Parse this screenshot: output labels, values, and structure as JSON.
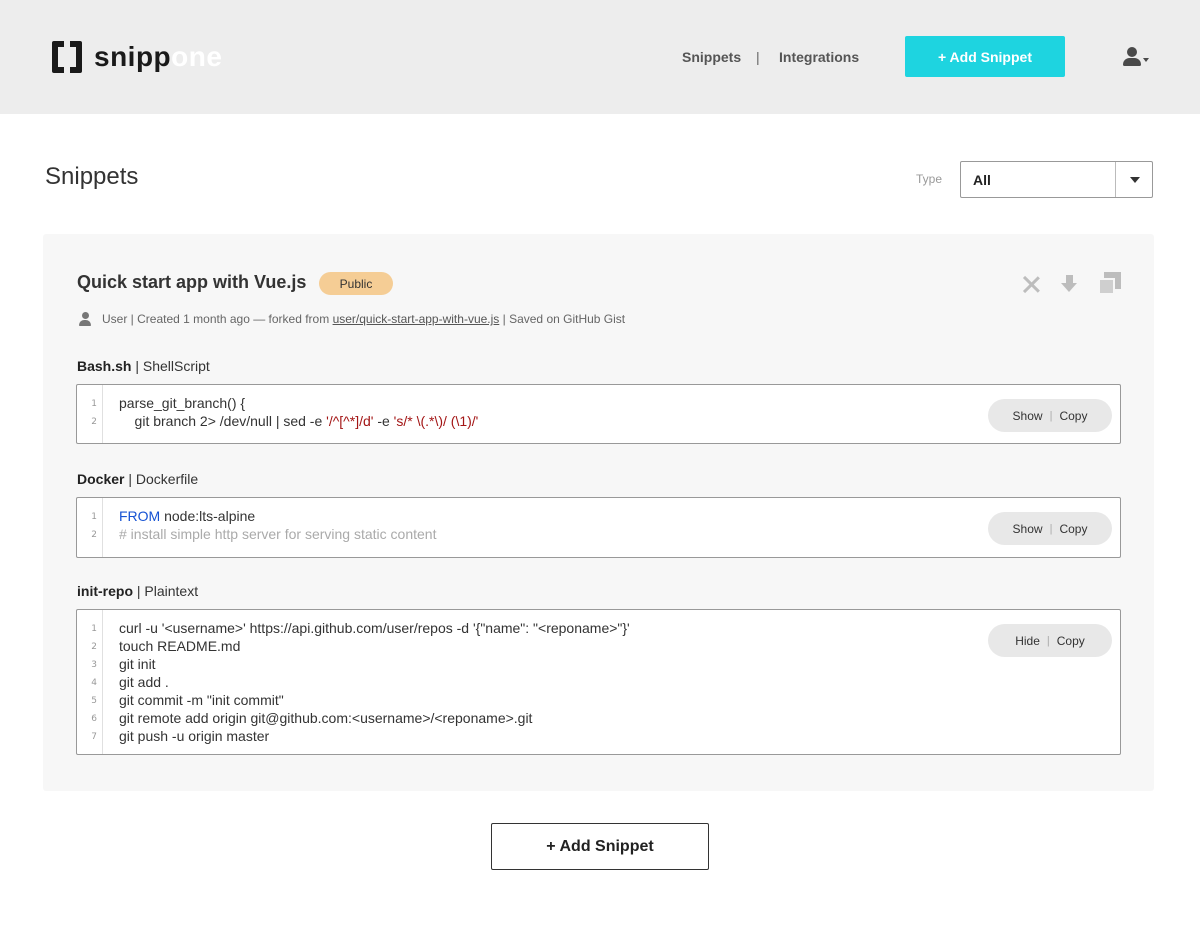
{
  "header": {
    "logo": {
      "part1": "snipp",
      "part2": "one"
    },
    "nav": {
      "snippets": "Snippets",
      "separator": "|",
      "integrations": "Integrations"
    },
    "add_button": "+ Add Snippet",
    "user_menu_icon": "user-icon"
  },
  "page": {
    "title": "Snippets",
    "type_filter": {
      "label": "Type",
      "value": "All"
    }
  },
  "snippet": {
    "title": "Quick start app with Vue.js",
    "visibility": "Public",
    "actions": [
      "close-icon",
      "download-icon",
      "duplicate-icon"
    ],
    "meta": {
      "prefix": "User | Created 1 month ago — forked from ",
      "fork_link": "user/quick-start-app-with-vue.js",
      "suffix": " | Saved on GitHub Gist"
    },
    "files": [
      {
        "name": "Bash.sh",
        "language": " | ShellScript",
        "toggle": "Show",
        "copy": "Copy",
        "lines": [
          {
            "n": "1",
            "parts": [
              {
                "t": "parse_git_branch() {",
                "c": ""
              }
            ]
          },
          {
            "n": "2",
            "parts": [
              {
                "t": "    git branch 2> /dev/null | sed -e ",
                "c": ""
              },
              {
                "t": "'/^[^*]/d'",
                "c": "str"
              },
              {
                "t": " -e ",
                "c": ""
              },
              {
                "t": "'s/* \\(.*\\)/ (\\1)/'",
                "c": "str"
              }
            ]
          }
        ]
      },
      {
        "name": "Docker",
        "language": " | Dockerfile",
        "toggle": "Show",
        "copy": "Copy",
        "lines": [
          {
            "n": "1",
            "parts": [
              {
                "t": "FROM",
                "c": "kw"
              },
              {
                "t": " node:lts-alpine",
                "c": ""
              }
            ]
          },
          {
            "n": "2",
            "parts": [
              {
                "t": "# install simple http server for serving static content",
                "c": "cmt"
              }
            ]
          }
        ]
      },
      {
        "name": "init-repo",
        "language": " | Plaintext",
        "toggle": "Hide",
        "copy": "Copy",
        "lines": [
          {
            "n": "1",
            "parts": [
              {
                "t": "curl -u '<username>' https://api.github.com/user/repos -d '{\"name\": \"<reponame>\"}'",
                "c": ""
              }
            ]
          },
          {
            "n": "2",
            "parts": [
              {
                "t": "touch README.md",
                "c": ""
              }
            ]
          },
          {
            "n": "3",
            "parts": [
              {
                "t": "git init",
                "c": ""
              }
            ]
          },
          {
            "n": "4",
            "parts": [
              {
                "t": "git add .",
                "c": ""
              }
            ]
          },
          {
            "n": "5",
            "parts": [
              {
                "t": "git commit -m \"init commit\"",
                "c": ""
              }
            ]
          },
          {
            "n": "6",
            "parts": [
              {
                "t": "git remote add origin git@github.com:<username>/<reponame>.git",
                "c": ""
              }
            ]
          },
          {
            "n": "7",
            "parts": [
              {
                "t": "git push -u origin master",
                "c": ""
              }
            ]
          }
        ]
      }
    ]
  },
  "footer": {
    "add_button": "+ Add Snippet"
  },
  "colors": {
    "accent": "#1ed4e0",
    "badge": "#f5cd95",
    "keyword": "#1552d3",
    "string": "#a31515",
    "comment": "#aaaaaa"
  }
}
